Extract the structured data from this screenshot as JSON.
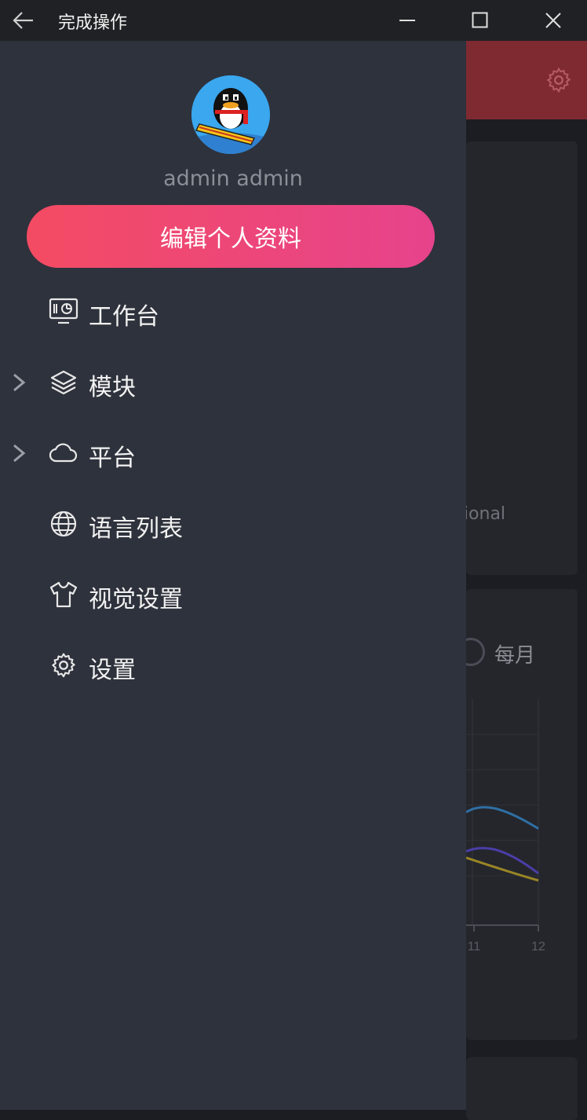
{
  "window": {
    "title": "完成操作",
    "back_icon": "arrow-left-icon",
    "minimize_icon": "minimize-icon",
    "maximize_icon": "maximize-icon",
    "close_icon": "close-icon"
  },
  "drawer": {
    "username": "admin admin",
    "edit_profile_label": "编辑个人资料",
    "menu": [
      {
        "label": "工作台",
        "icon": "dashboard-icon",
        "expandable": false
      },
      {
        "label": "模块",
        "icon": "layers-icon",
        "expandable": true
      },
      {
        "label": "平台",
        "icon": "cloud-icon",
        "expandable": true
      },
      {
        "label": "语言列表",
        "icon": "globe-icon",
        "expandable": false
      },
      {
        "label": "视觉设置",
        "icon": "tshirt-icon",
        "expandable": false
      },
      {
        "label": "设置",
        "icon": "gear-icon",
        "expandable": false
      }
    ]
  },
  "background": {
    "card_partial_text": "ssional",
    "period_option": "每月",
    "chart_ticks": [
      "11",
      "12"
    ]
  },
  "colors": {
    "drawer_bg": "#2e323c",
    "titlebar_bg": "#202124",
    "header_bg": "#7f2a31",
    "button_gradient_start": "#f44b63",
    "button_gradient_end": "#e6438c"
  }
}
